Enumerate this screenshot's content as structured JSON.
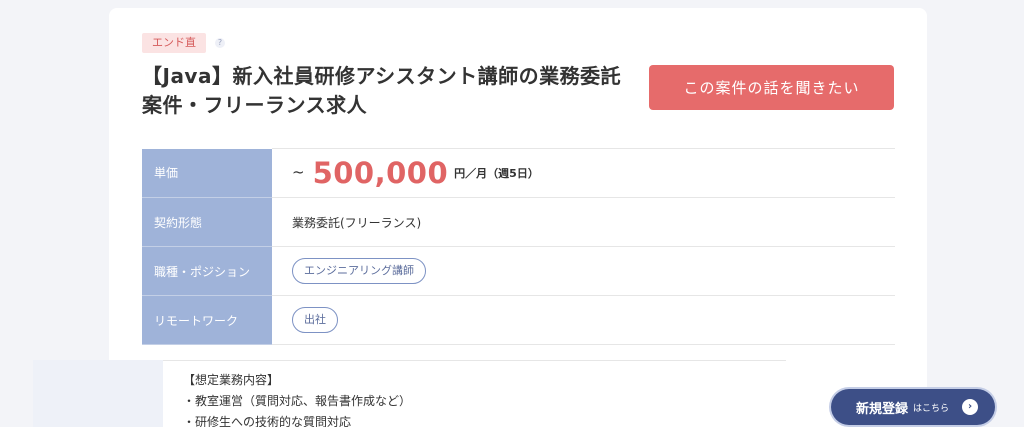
{
  "job": {
    "badge": "エンド直",
    "help_mark": "?",
    "title": "【Java】新入社員研修アシスタント講師の業務委託案件・フリーランス求人",
    "cta_label": "この案件の話を聞きたい"
  },
  "info": {
    "price": {
      "label": "単価",
      "tilde": "~",
      "value": "500,000",
      "unit": "円／月（週5日）"
    },
    "contract": {
      "label": "契約形態",
      "value": "業務委託(フリーランス)"
    },
    "position": {
      "label": "職種・ポジション",
      "tag": "エンジニアリング講師"
    },
    "remote": {
      "label": "リモートワーク",
      "tag": "出社"
    }
  },
  "description": {
    "lines": [
      "【想定業務内容】",
      "・教室運営（質問対応、報告書作成など）",
      "・研修生への技術的な質問対応"
    ]
  },
  "signup": {
    "label": "新規登録",
    "sub": "はこちら",
    "icon": "chevron-right-icon"
  },
  "colors": {
    "accent": "#e66b6b",
    "header": "#9fb3d9",
    "navy": "#3d4f87"
  }
}
